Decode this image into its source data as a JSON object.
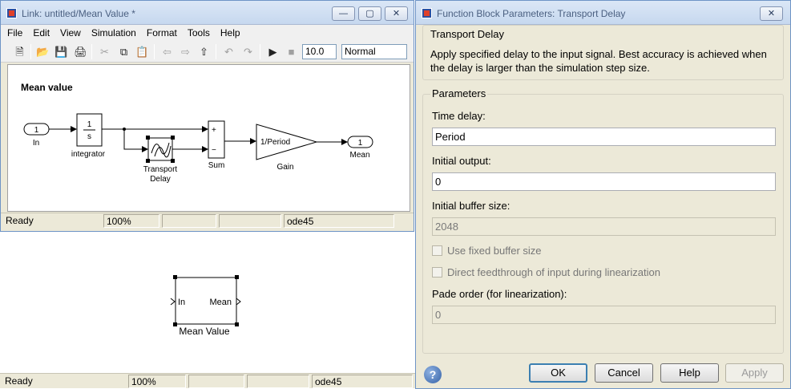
{
  "subsystem_window": {
    "title": "Link: untitled/Mean Value *",
    "menu": [
      "File",
      "Edit",
      "View",
      "Simulation",
      "Format",
      "Tools",
      "Help"
    ],
    "toolbar": {
      "stop_time": "10.0",
      "sim_mode": "Normal"
    },
    "canvas_title": "Mean value",
    "blocks": {
      "in_port_num": "1",
      "in_label": "In",
      "integrator_num": "1",
      "integrator_den": "s",
      "integrator_label": "integrator",
      "transport_label_1": "Transport",
      "transport_label_2": "Delay",
      "sum_plus": "+",
      "sum_minus": "−",
      "sum_label": "Sum",
      "gain_value": "1/Period",
      "gain_label": "Gain",
      "out_port_num": "1",
      "out_label": "Mean"
    },
    "status": {
      "state": "Ready",
      "zoom": "100%",
      "solver": "ode45"
    }
  },
  "parent_model": {
    "block": {
      "in_port": "In",
      "out_port": "Mean",
      "label": "Mean Value"
    },
    "status": {
      "state": "Ready",
      "zoom": "100%",
      "solver": "ode45"
    }
  },
  "dialog": {
    "title": "Function Block Parameters: Transport Delay",
    "block_type": "Transport Delay",
    "description_line_1": "Apply specified delay to the input signal.  Best accuracy is achieved when",
    "description_line_2": "the delay is larger than the simulation step size.",
    "parameters_label": "Parameters",
    "time_delay_label": "Time delay:",
    "time_delay_value": "Period",
    "initial_output_label": "Initial output:",
    "initial_output_value": "0",
    "buffer_size_label": "Initial buffer size:",
    "buffer_size_value": "2048",
    "fixed_buffer_label": "Use fixed buffer size",
    "direct_feedthrough_label": "Direct feedthrough of input during linearization",
    "pade_order_label": "Pade order (for linearization):",
    "pade_order_value": "0",
    "buttons": {
      "ok": "OK",
      "cancel": "Cancel",
      "help": "Help",
      "apply": "Apply"
    }
  }
}
